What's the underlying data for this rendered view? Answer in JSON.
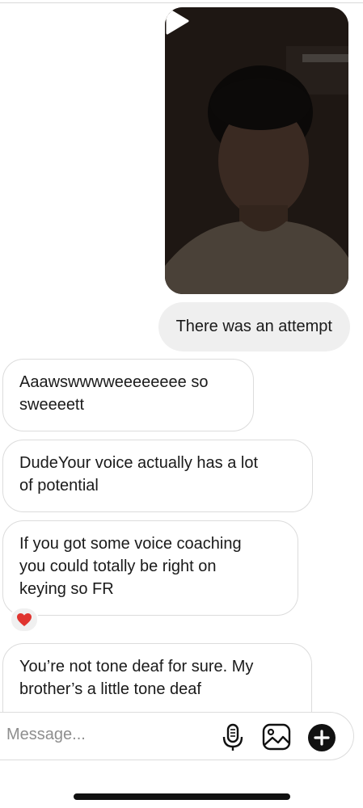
{
  "thread": {
    "video_message": {
      "media": "video-thumbnail",
      "play_icon": "play-icon"
    },
    "outgoing_text": "There was an attempt",
    "incoming": [
      {
        "lines": [
          "Aaawswwwweeeeeeee so",
          "sweeeett"
        ]
      },
      {
        "lines": [
          "DudeYour voice actually has a lot",
          "of potential"
        ]
      },
      {
        "lines": [
          "If you got some voice coaching",
          "you could totally be right on",
          "keying so FR"
        ],
        "reaction": "heart-reaction-icon"
      },
      {
        "lines": [
          "You’re not tone deaf for sure. My",
          "brother’s a little tone deaf"
        ]
      }
    ]
  },
  "composer": {
    "placeholder": "Message...",
    "icons": [
      "microphone-icon",
      "gallery-icon",
      "plus-circle-icon"
    ]
  },
  "colors": {
    "outgoing_bubble": "#efefef",
    "incoming_border": "#dcdcdc",
    "reaction_heart": "#e0342f"
  }
}
